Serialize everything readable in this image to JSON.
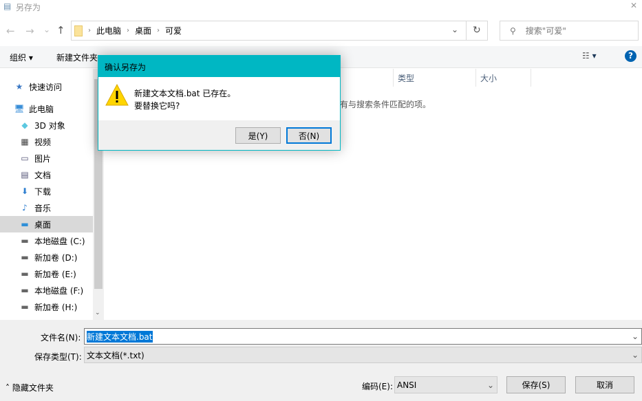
{
  "window": {
    "title": "另存为",
    "close": "✕"
  },
  "nav": {
    "back": "←",
    "forward": "→",
    "recent": "⌄",
    "up": "↑",
    "refresh": "↻",
    "breadcrumbs": [
      "此电脑",
      "桌面",
      "可爱"
    ],
    "search_placeholder": "搜索\"可爱\""
  },
  "toolbar": {
    "organize": "组织",
    "new_folder": "新建文件夹",
    "help": "?"
  },
  "sidebar": {
    "items": [
      {
        "label": "快速访问",
        "icon": "star-icon",
        "glyph": "★",
        "indent": false
      },
      {
        "label": "此电脑",
        "icon": "computer-icon",
        "glyph": "🖥",
        "indent": false
      },
      {
        "label": "3D 对象",
        "icon": "cube-icon",
        "glyph": "◆",
        "indent": true
      },
      {
        "label": "视频",
        "icon": "video-icon",
        "glyph": "▦",
        "indent": true
      },
      {
        "label": "图片",
        "icon": "picture-icon",
        "glyph": "▭",
        "indent": true
      },
      {
        "label": "文档",
        "icon": "document-icon",
        "glyph": "▤",
        "indent": true
      },
      {
        "label": "下载",
        "icon": "download-icon",
        "glyph": "⬇",
        "indent": true
      },
      {
        "label": "音乐",
        "icon": "music-icon",
        "glyph": "♪",
        "indent": true
      },
      {
        "label": "桌面",
        "icon": "desktop-icon",
        "glyph": "▬",
        "indent": true,
        "selected": true
      },
      {
        "label": "本地磁盘 (C:)",
        "icon": "drive-icon",
        "glyph": "▬",
        "indent": true
      },
      {
        "label": "新加卷 (D:)",
        "icon": "drive-icon",
        "glyph": "▬",
        "indent": true
      },
      {
        "label": "新加卷 (E:)",
        "icon": "drive-icon",
        "glyph": "▬",
        "indent": true
      },
      {
        "label": "本地磁盘 (F:)",
        "icon": "drive-icon",
        "glyph": "▬",
        "indent": true
      },
      {
        "label": "新加卷 (H:)",
        "icon": "drive-icon",
        "glyph": "▬",
        "indent": true
      }
    ]
  },
  "columns": {
    "type": "类型",
    "size": "大小"
  },
  "empty_message": "有与搜索条件匹配的项。",
  "form": {
    "filename_label": "文件名(N):",
    "filename_value": "新建文本文档.bat",
    "type_label": "保存类型(T):",
    "type_value": "文本文档(*.txt)",
    "encoding_label": "编码(E):",
    "encoding_value": "ANSI",
    "save": "保存(S)",
    "cancel": "取消",
    "hide_folders": "隐藏文件夹"
  },
  "dialog": {
    "title": "确认另存为",
    "line1": "新建文本文档.bat 已存在。",
    "line2": "要替换它吗?",
    "yes": "是(Y)",
    "no": "否(N)",
    "accent": "#00b7c3"
  }
}
